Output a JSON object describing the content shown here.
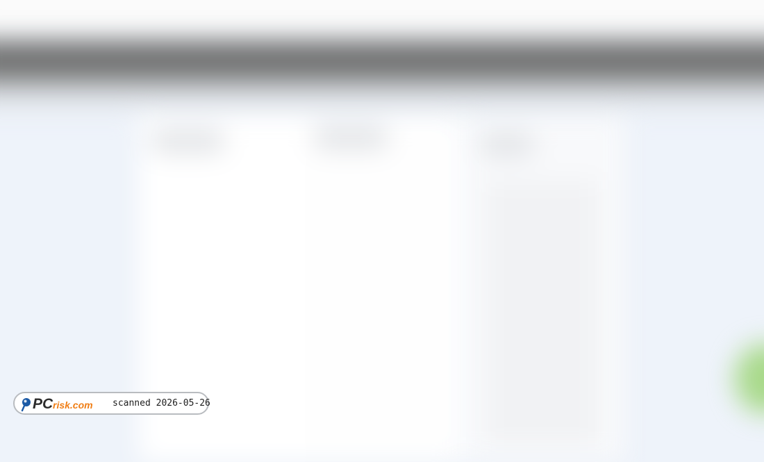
{
  "watermark": {
    "logo_text": "PCrisk.com",
    "scan_label": "scanned 2026-05-26"
  },
  "colors": {
    "logo_blue": "#1b5aa6",
    "logo_orange": "#f07e15",
    "header_gray": "#6f7070"
  }
}
